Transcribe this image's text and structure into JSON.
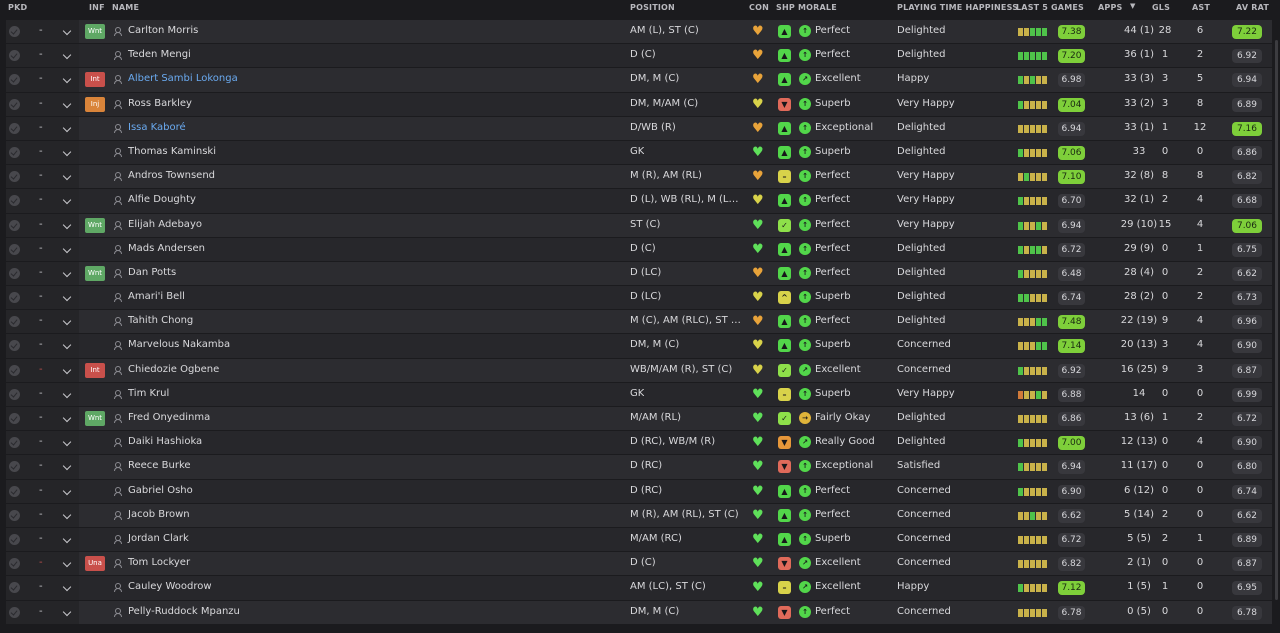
{
  "headers": {
    "pkd": "PKD",
    "inf": "INF",
    "name": "NAME",
    "position": "POSITION",
    "con": "CON",
    "shp": "SHP",
    "morale": "MORALE",
    "pth": "PLAYING TIME HAPPINESS",
    "last5": "LAST 5 GAMES",
    "apps": "APPS",
    "gls": "GLS",
    "ast": "AST",
    "avrat": "AV RAT"
  },
  "colors": {
    "green": "#7ecf3a",
    "inf_green": "#5fa865",
    "inf_red": "#c9504b",
    "inf_orange": "#d9843a",
    "link_blue": "#6aaaf0",
    "form_green": "#4fc34a",
    "form_yellow": "#c9b24a",
    "form_orange": "#d07a3a"
  },
  "rows": [
    {
      "pkd_dash": "-",
      "inf": "Wnt",
      "name": "Carlton Morris",
      "position": "AM (L), ST (C)",
      "con": "heart-half",
      "shp": "up",
      "morale_icon": "up",
      "morale": "Perfect",
      "pth": "Delighted",
      "form": [
        "y",
        "y",
        "g",
        "g",
        "g"
      ],
      "form_rating": "7.38",
      "form_hl": true,
      "apps": "44 (1)",
      "gls": "28",
      "ast": "6",
      "avrat": "7.22",
      "avrat_hl": true
    },
    {
      "pkd_dash": "-",
      "inf": "",
      "name": "Teden Mengi",
      "position": "D (C)",
      "con": "heart-half",
      "shp": "up",
      "morale_icon": "up",
      "morale": "Perfect",
      "pth": "Delighted",
      "form": [
        "g",
        "g",
        "g",
        "g",
        "g"
      ],
      "form_rating": "7.20",
      "form_hl": true,
      "apps": "36 (1)",
      "gls": "1",
      "ast": "2",
      "avrat": "6.92",
      "avrat_hl": false
    },
    {
      "pkd_dash": "-",
      "inf": "Int",
      "name": "Albert Sambi Lokonga",
      "link": true,
      "position": "DM, M (C)",
      "con": "heart-half",
      "shp": "up",
      "morale_icon": "up-right",
      "morale": "Excellent",
      "pth": "Happy",
      "form": [
        "g",
        "y",
        "g",
        "y",
        "y"
      ],
      "form_rating": "6.98",
      "form_hl": false,
      "apps": "33 (3)",
      "gls": "3",
      "ast": "5",
      "avrat": "6.94",
      "avrat_hl": false
    },
    {
      "pkd_dash": "-",
      "inf": "Inj",
      "name": "Ross Barkley",
      "position": "DM, M/AM (C)",
      "con": "heart-yellow",
      "shp": "down",
      "morale_icon": "up",
      "morale": "Superb",
      "pth": "Very Happy",
      "form": [
        "g",
        "y",
        "y",
        "y",
        "y"
      ],
      "form_rating": "7.04",
      "form_hl": true,
      "apps": "33 (2)",
      "gls": "3",
      "ast": "8",
      "avrat": "6.89",
      "avrat_hl": false
    },
    {
      "pkd_dash": "-",
      "inf": "",
      "name": "Issa Kaboré",
      "link": true,
      "position": "D/WB (R)",
      "con": "heart-half",
      "shp": "up",
      "morale_icon": "up",
      "morale": "Exceptional",
      "pth": "Delighted",
      "form": [
        "y",
        "y",
        "y",
        "y",
        "y"
      ],
      "form_rating": "6.94",
      "form_hl": false,
      "apps": "33 (1)",
      "gls": "1",
      "ast": "12",
      "avrat": "7.16",
      "avrat_hl": true
    },
    {
      "pkd_dash": "-",
      "inf": "",
      "name": "Thomas Kaminski",
      "position": "GK",
      "con": "heart-green",
      "shp": "up",
      "morale_icon": "up",
      "morale": "Superb",
      "pth": "Delighted",
      "form": [
        "g",
        "y",
        "y",
        "y",
        "y"
      ],
      "form_rating": "7.06",
      "form_hl": true,
      "apps": "33",
      "gls": "0",
      "ast": "0",
      "avrat": "6.86",
      "avrat_hl": false
    },
    {
      "pkd_dash": "-",
      "inf": "",
      "name": "Andros Townsend",
      "position": "M (R), AM (RL)",
      "con": "heart-half",
      "shp": "flat",
      "morale_icon": "up",
      "morale": "Perfect",
      "pth": "Very Happy",
      "form": [
        "y",
        "g",
        "y",
        "y",
        "y"
      ],
      "form_rating": "7.10",
      "form_hl": true,
      "apps": "32 (8)",
      "gls": "8",
      "ast": "8",
      "avrat": "6.82",
      "avrat_hl": false
    },
    {
      "pkd_dash": "-",
      "inf": "",
      "name": "Alfie Doughty",
      "position": "D (L), WB (RL), M (L),...",
      "con": "heart-yellow",
      "shp": "up",
      "morale_icon": "up",
      "morale": "Perfect",
      "pth": "Very Happy",
      "form": [
        "g",
        "y",
        "y",
        "y",
        "y"
      ],
      "form_rating": "6.70",
      "form_hl": false,
      "apps": "32 (1)",
      "gls": "2",
      "ast": "4",
      "avrat": "6.68",
      "avrat_hl": false
    },
    {
      "pkd_dash": "-",
      "inf": "Wnt",
      "name": "Elijah Adebayo",
      "position": "ST (C)",
      "con": "heart-green",
      "shp": "check",
      "morale_icon": "up",
      "morale": "Perfect",
      "pth": "Very Happy",
      "form": [
        "g",
        "y",
        "y",
        "g",
        "y"
      ],
      "form_rating": "6.94",
      "form_hl": false,
      "apps": "29 (10)",
      "gls": "15",
      "ast": "4",
      "avrat": "7.06",
      "avrat_hl": true
    },
    {
      "pkd_dash": "-",
      "inf": "",
      "name": "Mads Andersen",
      "position": "D (C)",
      "con": "heart-green",
      "shp": "up",
      "morale_icon": "up",
      "morale": "Perfect",
      "pth": "Delighted",
      "form": [
        "g",
        "y",
        "g",
        "g",
        "y"
      ],
      "form_rating": "6.72",
      "form_hl": false,
      "apps": "29 (9)",
      "gls": "0",
      "ast": "1",
      "avrat": "6.75",
      "avrat_hl": false
    },
    {
      "pkd_dash": "-",
      "inf": "Wnt",
      "name": "Dan Potts",
      "position": "D (LC)",
      "con": "heart-half",
      "shp": "up",
      "morale_icon": "up",
      "morale": "Perfect",
      "pth": "Delighted",
      "form": [
        "g",
        "y",
        "y",
        "y",
        "y"
      ],
      "form_rating": "6.48",
      "form_hl": false,
      "apps": "28 (4)",
      "gls": "0",
      "ast": "2",
      "avrat": "6.62",
      "avrat_hl": false
    },
    {
      "pkd_dash": "-",
      "inf": "",
      "name": "Amari'i Bell",
      "position": "D (LC)",
      "con": "heart-yellow",
      "shp": "upsm",
      "morale_icon": "up",
      "morale": "Superb",
      "pth": "Delighted",
      "form": [
        "g",
        "g",
        "y",
        "y",
        "y"
      ],
      "form_rating": "6.74",
      "form_hl": false,
      "apps": "28 (2)",
      "gls": "0",
      "ast": "2",
      "avrat": "6.73",
      "avrat_hl": false
    },
    {
      "pkd_dash": "-",
      "inf": "",
      "name": "Tahith Chong",
      "position": "M (C), AM (RLC), ST (C)",
      "con": "heart-half",
      "shp": "up",
      "morale_icon": "up",
      "morale": "Perfect",
      "pth": "Delighted",
      "form": [
        "y",
        "y",
        "y",
        "g",
        "g"
      ],
      "form_rating": "7.48",
      "form_hl": true,
      "apps": "22 (19)",
      "gls": "9",
      "ast": "4",
      "avrat": "6.96",
      "avrat_hl": false
    },
    {
      "pkd_dash": "-",
      "inf": "",
      "name": "Marvelous Nakamba",
      "position": "DM, M (C)",
      "con": "heart-yellow",
      "shp": "up",
      "morale_icon": "up",
      "morale": "Superb",
      "pth": "Concerned",
      "form": [
        "y",
        "y",
        "y",
        "g",
        "g"
      ],
      "form_rating": "7.14",
      "form_hl": true,
      "apps": "20 (13)",
      "gls": "3",
      "ast": "4",
      "avrat": "6.90",
      "avrat_hl": false
    },
    {
      "pkd_dash": "-",
      "pkd_red": true,
      "inf": "Int",
      "name": "Chiedozie Ogbene",
      "position": "WB/M/AM (R), ST (C)",
      "con": "heart-yellow",
      "shp": "check",
      "morale_icon": "up-right",
      "morale": "Excellent",
      "pth": "Concerned",
      "form": [
        "g",
        "y",
        "y",
        "y",
        "y"
      ],
      "form_rating": "6.92",
      "form_hl": false,
      "apps": "16 (25)",
      "gls": "9",
      "ast": "3",
      "avrat": "6.87",
      "avrat_hl": false
    },
    {
      "pkd_dash": "-",
      "inf": "",
      "name": "Tim Krul",
      "position": "GK",
      "con": "heart-green",
      "shp": "flat",
      "morale_icon": "up",
      "morale": "Superb",
      "pth": "Very Happy",
      "form": [
        "o",
        "y",
        "y",
        "g",
        "y"
      ],
      "form_rating": "6.88",
      "form_hl": false,
      "apps": "14",
      "gls": "0",
      "ast": "0",
      "avrat": "6.99",
      "avrat_hl": false
    },
    {
      "pkd_dash": "-",
      "inf": "Wnt",
      "name": "Fred Onyedinma",
      "position": "M/AM (RL)",
      "con": "heart-green",
      "shp": "check",
      "morale_icon": "right",
      "morale": "Fairly Okay",
      "pth": "Delighted",
      "form": [
        "y",
        "y",
        "y",
        "y",
        "y"
      ],
      "form_rating": "6.86",
      "form_hl": false,
      "apps": "13 (6)",
      "gls": "1",
      "ast": "2",
      "avrat": "6.72",
      "avrat_hl": false
    },
    {
      "pkd_dash": "-",
      "inf": "",
      "name": "Daiki Hashioka",
      "position": "D (RC), WB/M (R)",
      "con": "heart-green",
      "shp": "down-o",
      "morale_icon": "up-right",
      "morale": "Really Good",
      "pth": "Delighted",
      "form": [
        "g",
        "y",
        "y",
        "y",
        "y"
      ],
      "form_rating": "7.00",
      "form_hl": true,
      "apps": "12 (13)",
      "gls": "0",
      "ast": "4",
      "avrat": "6.90",
      "avrat_hl": false
    },
    {
      "pkd_dash": "-",
      "inf": "",
      "name": "Reece Burke",
      "position": "D (RC)",
      "con": "heart-green",
      "shp": "down",
      "morale_icon": "up",
      "morale": "Exceptional",
      "pth": "Satisfied",
      "form": [
        "g",
        "y",
        "y",
        "y",
        "y"
      ],
      "form_rating": "6.94",
      "form_hl": false,
      "apps": "11 (17)",
      "gls": "0",
      "ast": "0",
      "avrat": "6.80",
      "avrat_hl": false
    },
    {
      "pkd_dash": "-",
      "inf": "",
      "name": "Gabriel Osho",
      "position": "D (RC)",
      "con": "heart-green",
      "shp": "up",
      "morale_icon": "up",
      "morale": "Perfect",
      "pth": "Concerned",
      "form": [
        "g",
        "y",
        "y",
        "y",
        "y"
      ],
      "form_rating": "6.90",
      "form_hl": false,
      "apps": "6 (12)",
      "gls": "0",
      "ast": "0",
      "avrat": "6.74",
      "avrat_hl": false
    },
    {
      "pkd_dash": "-",
      "inf": "",
      "name": "Jacob Brown",
      "position": "M (R), AM (RL), ST (C)",
      "con": "heart-green",
      "shp": "up",
      "morale_icon": "up",
      "morale": "Perfect",
      "pth": "Concerned",
      "form": [
        "y",
        "y",
        "g",
        "y",
        "y"
      ],
      "form_rating": "6.62",
      "form_hl": false,
      "apps": "5 (14)",
      "gls": "2",
      "ast": "0",
      "avrat": "6.62",
      "avrat_hl": false
    },
    {
      "pkd_dash": "-",
      "inf": "",
      "name": "Jordan Clark",
      "position": "M/AM (RC)",
      "con": "heart-green",
      "shp": "up",
      "morale_icon": "up",
      "morale": "Superb",
      "pth": "Concerned",
      "form": [
        "y",
        "y",
        "y",
        "y",
        "y"
      ],
      "form_rating": "6.72",
      "form_hl": false,
      "apps": "5 (5)",
      "gls": "2",
      "ast": "1",
      "avrat": "6.89",
      "avrat_hl": false
    },
    {
      "pkd_dash": "-",
      "pkd_red": true,
      "inf": "Una",
      "name": "Tom Lockyer",
      "position": "D (C)",
      "con": "heart-green",
      "shp": "down",
      "morale_icon": "up-right",
      "morale": "Excellent",
      "pth": "Concerned",
      "form": [
        "y",
        "y",
        "y",
        "y",
        "y"
      ],
      "form_rating": "6.82",
      "form_hl": false,
      "apps": "2 (1)",
      "gls": "0",
      "ast": "0",
      "avrat": "6.87",
      "avrat_hl": false
    },
    {
      "pkd_dash": "-",
      "inf": "",
      "name": "Cauley Woodrow",
      "position": "AM (LC), ST (C)",
      "con": "heart-green",
      "shp": "flat",
      "morale_icon": "up-right",
      "morale": "Excellent",
      "pth": "Happy",
      "form": [
        "g",
        "y",
        "y",
        "y",
        "y"
      ],
      "form_rating": "7.12",
      "form_hl": true,
      "apps": "1 (5)",
      "gls": "1",
      "ast": "0",
      "avrat": "6.95",
      "avrat_hl": false
    },
    {
      "pkd_dash": "-",
      "inf": "",
      "name": "Pelly-Ruddock Mpanzu",
      "position": "DM, M (C)",
      "con": "heart-green",
      "shp": "down",
      "morale_icon": "up",
      "morale": "Perfect",
      "pth": "Concerned",
      "form": [
        "y",
        "y",
        "y",
        "y",
        "y"
      ],
      "form_rating": "6.78",
      "form_hl": false,
      "apps": "0 (5)",
      "gls": "0",
      "ast": "0",
      "avrat": "6.78",
      "avrat_hl": false
    }
  ]
}
